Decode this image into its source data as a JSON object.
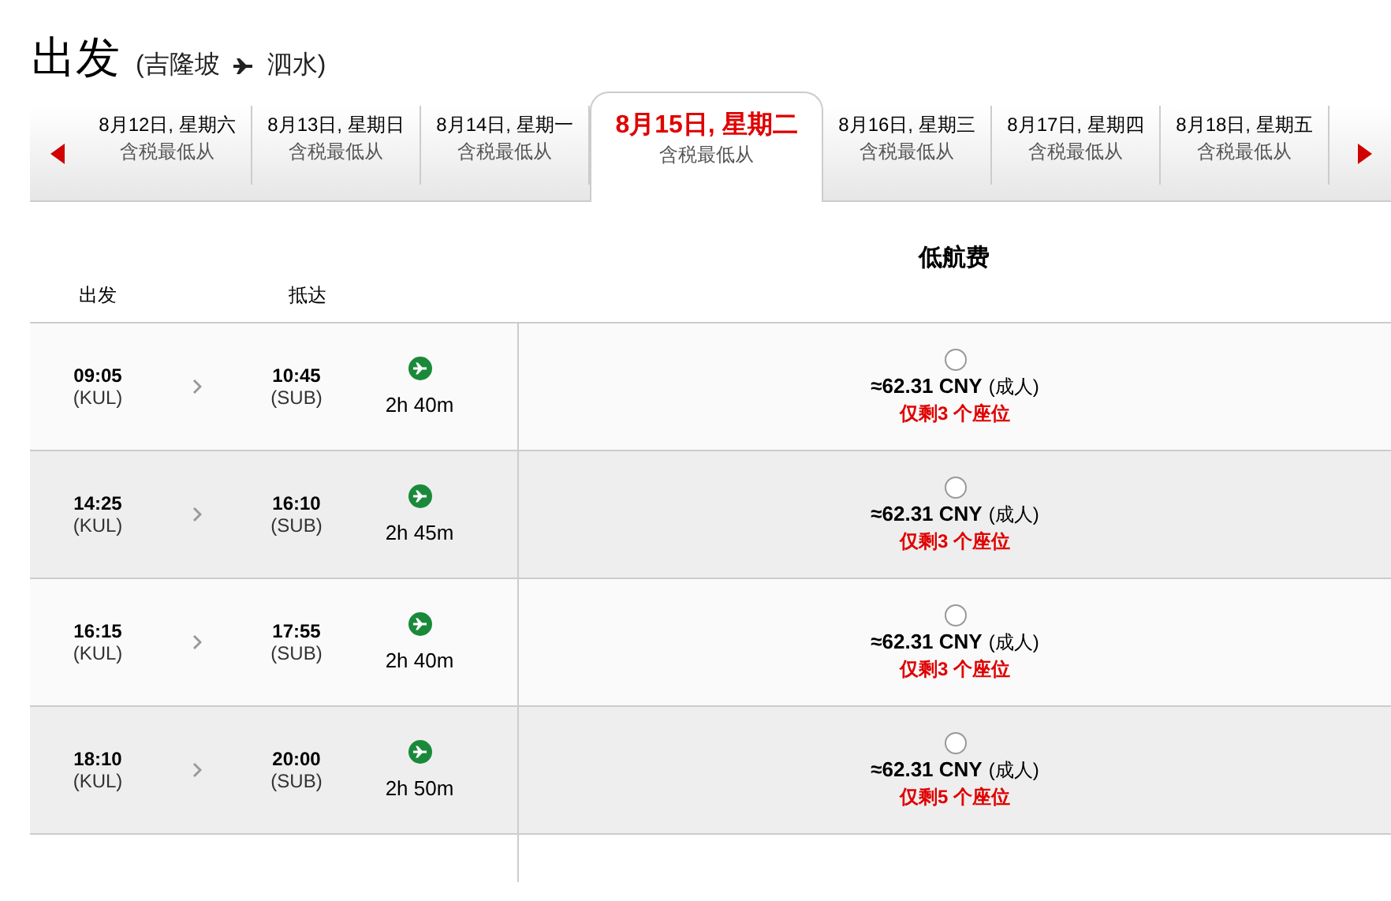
{
  "heading": {
    "title": "出发",
    "route_open": "(吉隆坡",
    "route_close": "泗水)"
  },
  "dates": [
    {
      "date": "8月12日, 星期六",
      "note": "含税最低从",
      "selected": false
    },
    {
      "date": "8月13日, 星期日",
      "note": "含税最低从",
      "selected": false
    },
    {
      "date": "8月14日, 星期一",
      "note": "含税最低从",
      "selected": false
    },
    {
      "date": "8月15日, 星期二",
      "note": "含税最低从",
      "selected": true
    },
    {
      "date": "8月16日, 星期三",
      "note": "含税最低从",
      "selected": false
    },
    {
      "date": "8月17日, 星期四",
      "note": "含税最低从",
      "selected": false
    },
    {
      "date": "8月18日, 星期五",
      "note": "含税最低从",
      "selected": false
    }
  ],
  "fare_title": "低航费",
  "columns": {
    "depart": "出发",
    "arrive": "抵达"
  },
  "flights": [
    {
      "dep_time": "09:05",
      "dep_code": "(KUL)",
      "arr_time": "10:45",
      "arr_code": "(SUB)",
      "duration": "2h 40m",
      "price": "≈62.31 CNY",
      "pax": "(成人)",
      "seats": "仅剩3 个座位",
      "selected": false
    },
    {
      "dep_time": "14:25",
      "dep_code": "(KUL)",
      "arr_time": "16:10",
      "arr_code": "(SUB)",
      "duration": "2h 45m",
      "price": "≈62.31 CNY",
      "pax": "(成人)",
      "seats": "仅剩3 个座位",
      "selected": false
    },
    {
      "dep_time": "16:15",
      "dep_code": "(KUL)",
      "arr_time": "17:55",
      "arr_code": "(SUB)",
      "duration": "2h 40m",
      "price": "≈62.31 CNY",
      "pax": "(成人)",
      "seats": "仅剩3 个座位",
      "selected": false
    },
    {
      "dep_time": "18:10",
      "dep_code": "(KUL)",
      "arr_time": "20:00",
      "arr_code": "(SUB)",
      "duration": "2h 50m",
      "price": "≈62.31 CNY",
      "pax": "(成人)",
      "seats": "仅剩5 个座位",
      "selected": false
    }
  ]
}
